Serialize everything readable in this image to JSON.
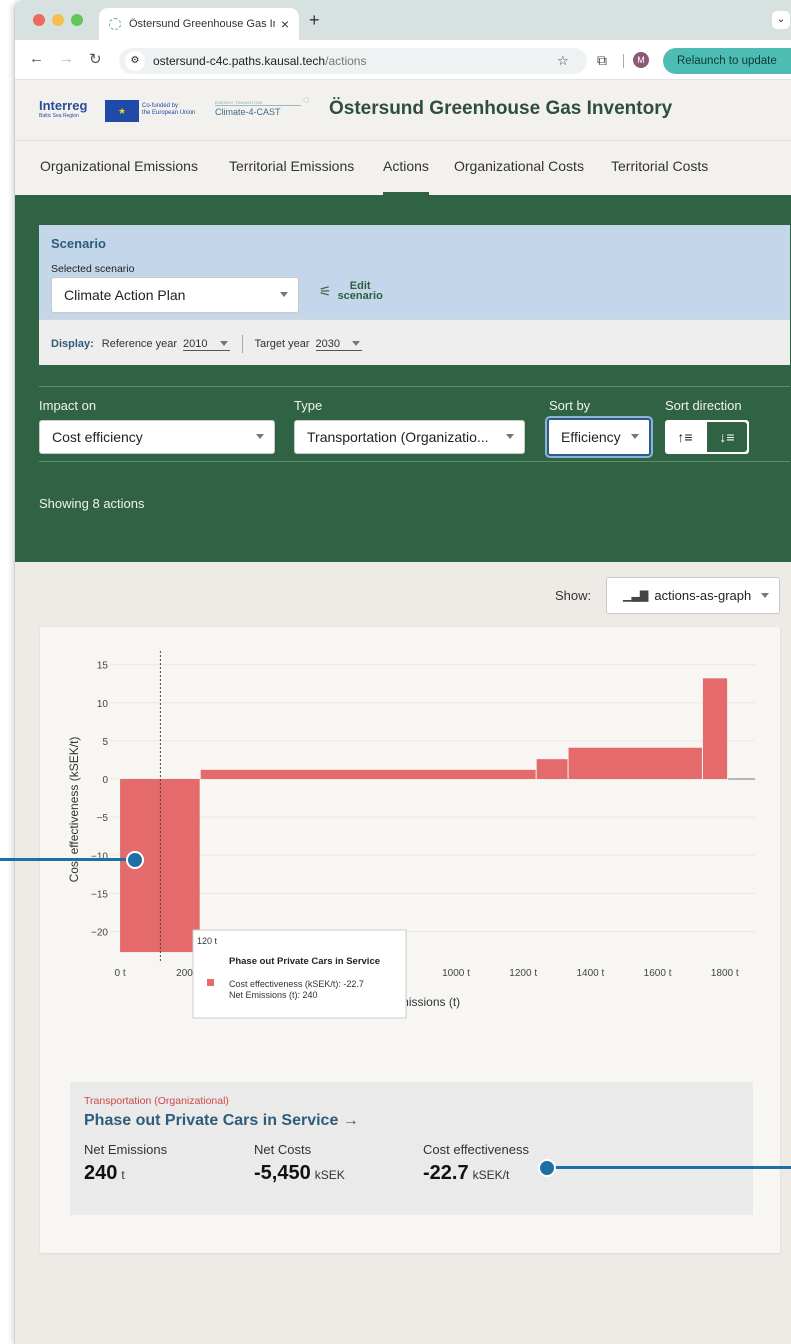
{
  "browser": {
    "tab_title": "Östersund Greenhouse Gas In",
    "tab_close": "×",
    "new_tab": "+",
    "url_host": "ostersund-c4c.paths.kausal.tech",
    "url_path": "/actions",
    "profile_initial": "M",
    "relaunch_label": "Relaunch to update"
  },
  "header": {
    "interreg": "Interreg",
    "interreg_sub": "Baltic Sea Region",
    "eu_line1": "Co-funded by",
    "eu_line2": "the European Union",
    "c4c_small": "ENERGY TRANSITION",
    "c4c_label": "Climate-4-CAST",
    "title": "Östersund Greenhouse Gas Inventory"
  },
  "nav": {
    "items": [
      "Organizational Emissions",
      "Territorial Emissions",
      "Actions",
      "Organizational Costs",
      "Territorial Costs"
    ],
    "active_index": 2
  },
  "scenario": {
    "title": "Scenario",
    "selected_label": "Selected scenario",
    "selected_value": "Climate Action Plan",
    "edit_line1": "Edit",
    "edit_line2": "scenario",
    "display_label": "Display:",
    "ref_year_label": "Reference year",
    "ref_year": "2010",
    "target_year_label": "Target year",
    "target_year": "2030"
  },
  "filters": {
    "impact_label": "Impact on",
    "impact_value": "Cost efficiency",
    "type_label": "Type",
    "type_value": "Transportation (Organizatio...",
    "sort_label": "Sort by",
    "sort_value": "Efficiency",
    "sortdir_label": "Sort direction",
    "sortdir_asc": "↑≡",
    "sortdir_desc": "↓≡",
    "showing": "Showing 8 actions"
  },
  "view": {
    "show_label": "Show:",
    "show_value": "actions-as-graph"
  },
  "chart_data": {
    "type": "bar",
    "xlabel": "Net Emissions  (t)",
    "ylabel": "Cost effectiveness  (kSEK/t)",
    "xlim": [
      -30,
      1890
    ],
    "ylim": [
      -24,
      16
    ],
    "x_ticks": [
      0,
      200,
      400,
      600,
      800,
      1000,
      1200,
      1400,
      1600,
      1800
    ],
    "x_tick_labels": [
      "0 t",
      "200 t",
      "",
      "",
      "",
      "1000 t",
      "1200 t",
      "1400 t",
      "1600 t",
      "1800 t"
    ],
    "y_ticks": [
      15,
      10,
      5,
      0,
      -5,
      -10,
      -15,
      -20
    ],
    "reference_line_x": 120,
    "color": "#e46a6c",
    "bars": [
      {
        "x_start": 0,
        "width": 240,
        "value": -22.7
      },
      {
        "x_start": 240,
        "width": 1000,
        "value": 1.2
      },
      {
        "x_start": 1240,
        "width": 95,
        "value": 2.6
      },
      {
        "x_start": 1335,
        "width": 400,
        "value": 4.1
      },
      {
        "x_start": 1735,
        "width": 75,
        "value": 13.2
      },
      {
        "x_start": 1810,
        "width": 80,
        "value": 0
      }
    ],
    "tooltip": {
      "header": "120 t",
      "title": "Phase out Private Cars in Service",
      "line1": "Cost effectiveness (kSEK/t): -22.7",
      "line2": "Net Emissions  (t): 240"
    }
  },
  "selected_action": {
    "category": "Transportation (Organizational)",
    "title": "Phase out Private Cars in Service →",
    "net_emissions_label": "Net Emissions",
    "net_emissions_value": "240",
    "net_emissions_unit": "t",
    "net_costs_label": "Net Costs",
    "net_costs_value": "-5,450",
    "net_costs_unit": "kSEK",
    "cost_eff_label": "Cost effectiveness",
    "cost_eff_value": "-22.7",
    "cost_eff_unit": "kSEK/t"
  }
}
